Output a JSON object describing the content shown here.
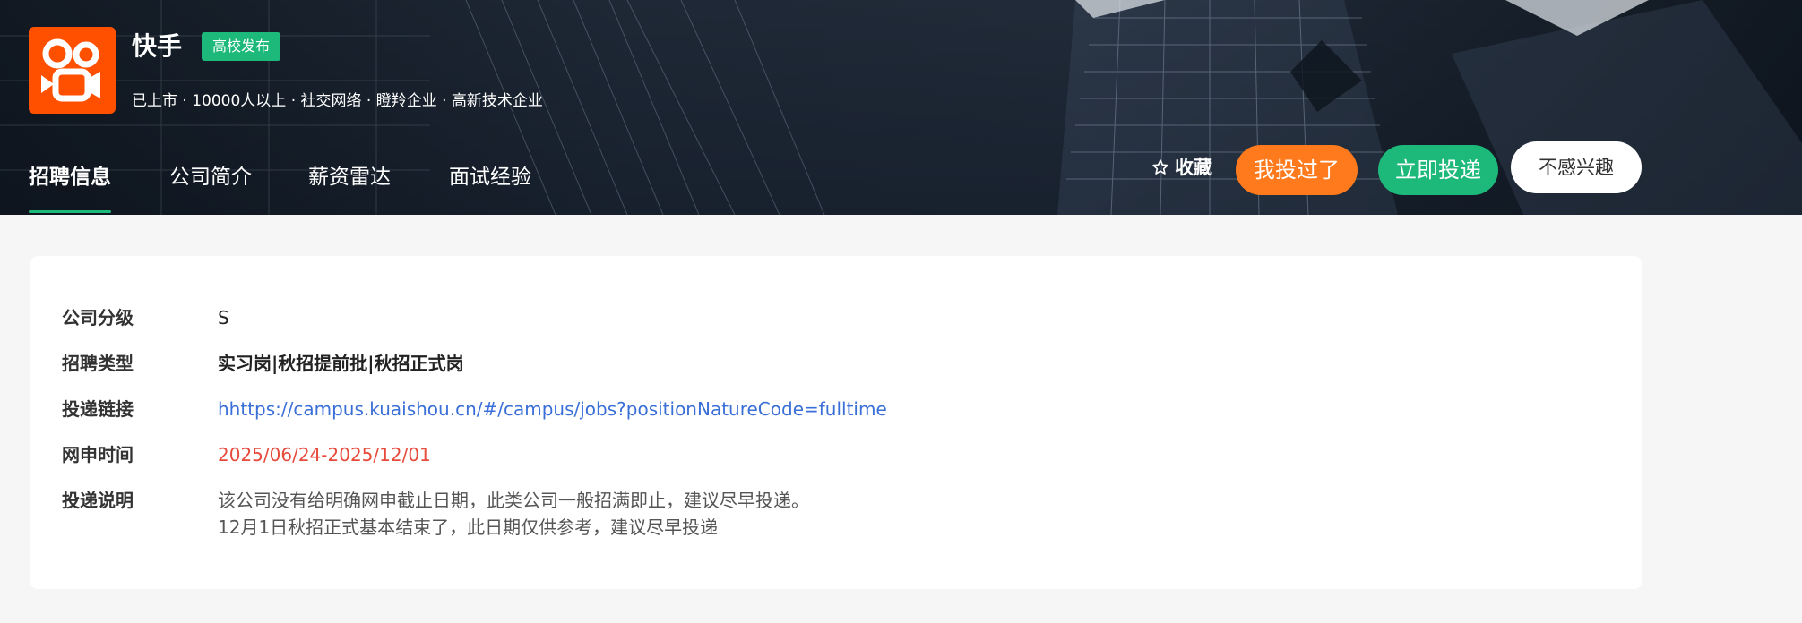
{
  "company": {
    "name": "快手",
    "badge": "高校发布",
    "meta": "已上市 · 10000人以上 · 社交网络 · 瞪羚企业 · 高新技术企业",
    "logo_color": "#ff5000"
  },
  "tabs": [
    {
      "label": "招聘信息",
      "active": true
    },
    {
      "label": "公司简介",
      "active": false
    },
    {
      "label": "薪资雷达",
      "active": false
    },
    {
      "label": "面试经验",
      "active": false
    }
  ],
  "actions": {
    "favorite_label": "收藏",
    "favorite_icon": "star-outline-icon",
    "applied_label": "我投过了",
    "apply_label": "立即投递",
    "not_interested_label": "不感兴趣"
  },
  "details": {
    "level": {
      "label": "公司分级",
      "value": "S"
    },
    "type": {
      "label": "招聘类型",
      "value": "实习岗|秋招提前批|秋招正式岗"
    },
    "link": {
      "label": "投递链接",
      "value": "hhttps://campus.kuaishou.cn/#/campus/jobs?positionNatureCode=fulltime"
    },
    "period": {
      "label": "网申时间",
      "value": "2025/06/24-2025/12/01"
    },
    "note": {
      "label": "投递说明",
      "lines": [
        "该公司没有给明确网申截止日期，此类公司一般招满即止，建议尽早投递。",
        "12月1日秋招正式基本结束了，此日期仅供参考，建议尽早投递"
      ]
    }
  },
  "colors": {
    "accent_green": "#1db97a",
    "accent_orange": "#ff7a1c",
    "link_blue": "#3a6fd8",
    "date_red": "#e64a3b",
    "page_bg": "#f6f6f7"
  }
}
